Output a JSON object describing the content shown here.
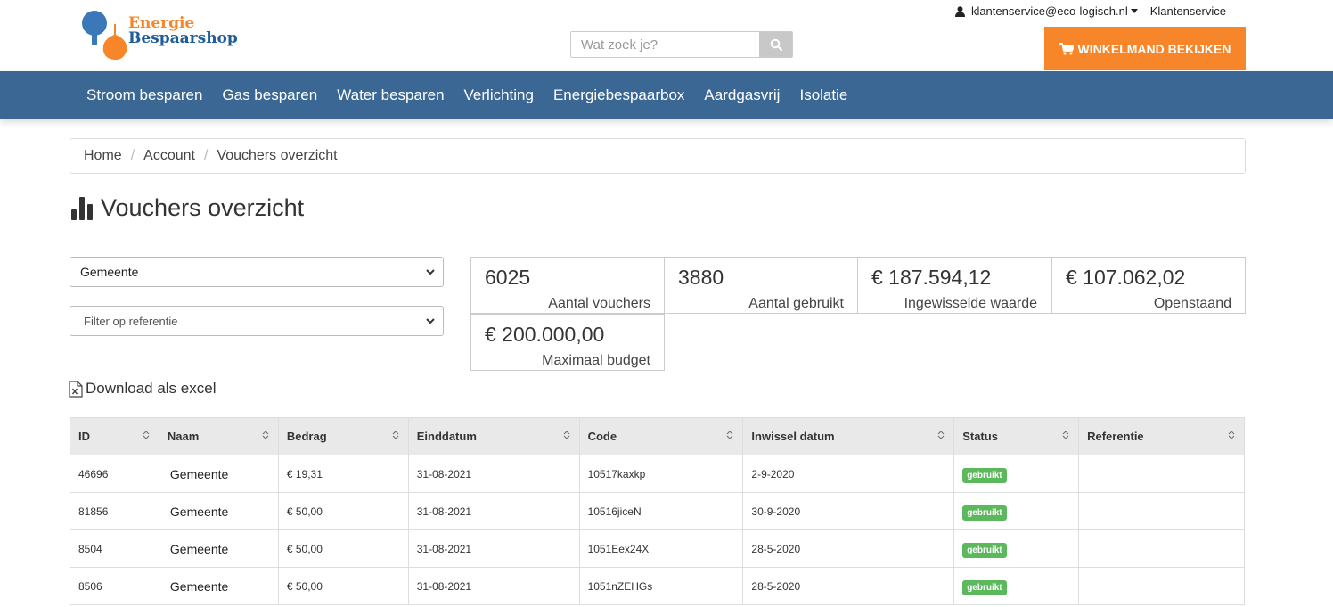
{
  "header": {
    "logo_line1": "Energie",
    "logo_line2": "Bespaarshop",
    "search_placeholder": "Wat zoek je?",
    "user_email": "klantenservice@eco-logisch.nl",
    "service_link": "Klantenservice",
    "cart_button": "WINKELMAND BEKIJKEN",
    "brand_orange": "#f7862a",
    "brand_blue": "#3a6794"
  },
  "nav": {
    "items": [
      "Stroom besparen",
      "Gas besparen",
      "Water besparen",
      "Verlichting",
      "Energiebespaarbox",
      "Aardgasvrij",
      "Isolatie"
    ]
  },
  "breadcrumb": [
    "Home",
    "Account",
    "Vouchers overzicht"
  ],
  "page_title": "Vouchers overzicht",
  "filters": {
    "gemeente": "Gemeente",
    "referentie": "Filter op referentie"
  },
  "stats": [
    {
      "value": "6025",
      "label": "Aantal vouchers"
    },
    {
      "value": "3880",
      "label": "Aantal gebruikt"
    },
    {
      "value": "€ 187.594,12",
      "label": "Ingewisselde waarde"
    },
    {
      "value": "€ 107.062,02",
      "label": "Openstaand"
    },
    {
      "value": "€ 200.000,00",
      "label": "Maximaal budget"
    }
  ],
  "download_label": "Download als excel",
  "table": {
    "headers": [
      "ID",
      "Naam",
      "Bedrag",
      "Einddatum",
      "Code",
      "Inwissel datum",
      "Status",
      "Referentie"
    ],
    "rows": [
      {
        "id": "46696",
        "naam": "Gemeente",
        "bedrag": "€ 19,31",
        "einddatum": "31-08-2021",
        "code": "10517kaxkp",
        "inwissel": "2-9-2020",
        "status": "gebruikt",
        "referentie": ""
      },
      {
        "id": "81856",
        "naam": "Gemeente",
        "bedrag": "€ 50,00",
        "einddatum": "31-08-2021",
        "code": "10516jiceN",
        "inwissel": "30-9-2020",
        "status": "gebruikt",
        "referentie": ""
      },
      {
        "id": "8504",
        "naam": "Gemeente",
        "bedrag": "€ 50,00",
        "einddatum": "31-08-2021",
        "code": "1051Eex24X",
        "inwissel": "28-5-2020",
        "status": "gebruikt",
        "referentie": ""
      },
      {
        "id": "8506",
        "naam": "Gemeente",
        "bedrag": "€ 50,00",
        "einddatum": "31-08-2021",
        "code": "1051nZEHGs",
        "inwissel": "28-5-2020",
        "status": "gebruikt",
        "referentie": ""
      }
    ]
  }
}
